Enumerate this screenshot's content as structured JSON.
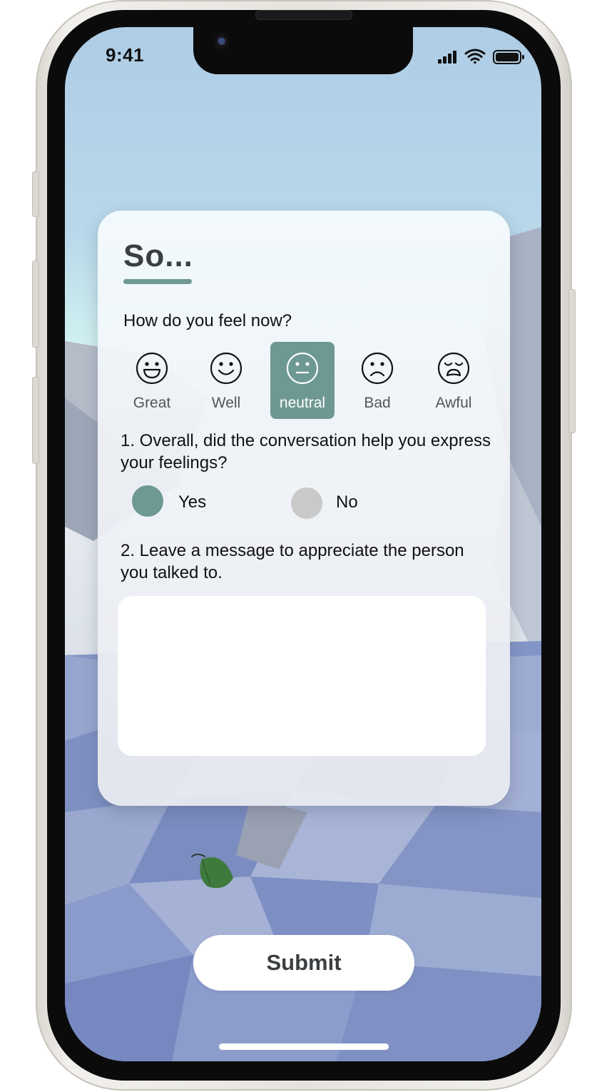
{
  "status_bar": {
    "time": "9:41",
    "icons": [
      "signal-icon",
      "wifi-icon",
      "battery-icon"
    ]
  },
  "card": {
    "title": "So...",
    "mood_prompt": "How do you feel now?",
    "moods": [
      {
        "label": "Great",
        "icon": "grinning-face-icon"
      },
      {
        "label": "Well",
        "icon": "smiling-face-icon"
      },
      {
        "label": "neutral",
        "icon": "neutral-face-icon"
      },
      {
        "label": "Bad",
        "icon": "frowning-face-icon"
      },
      {
        "label": "Awful",
        "icon": "weary-face-icon"
      }
    ],
    "selected_mood": "neutral",
    "question_1": "1. Overall, did the conversation help you express your feelings?",
    "options": [
      {
        "label": "Yes",
        "selected": true
      },
      {
        "label": "No",
        "selected": false
      }
    ],
    "question_2": "2. Leave a message to appreciate the person you talked to.",
    "message": {
      "value": "",
      "placeholder": ""
    }
  },
  "submit_label": "Submit",
  "colors": {
    "accent": "#6e9893",
    "unselected_radio": "#c9c9c9",
    "title": "#3b3f41"
  }
}
